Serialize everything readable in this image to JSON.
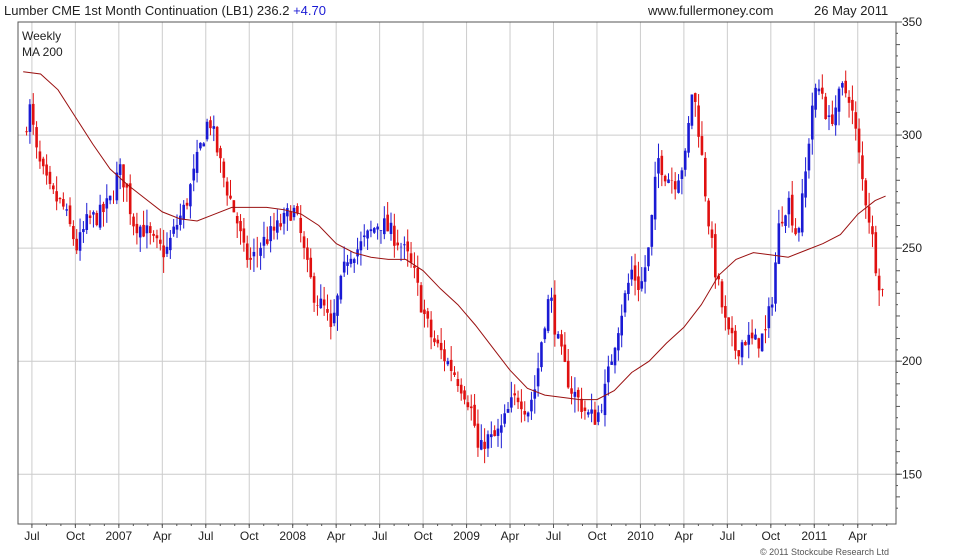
{
  "header": {
    "title": "Lumber CME 1st Month Continuation (LB1) 236.2",
    "change": "+4.70",
    "site": "www.fullermoney.com",
    "date": "26 May 2011"
  },
  "legend": {
    "period": "Weekly",
    "ma": "MA 200"
  },
  "footer": {
    "copyright": "© 2011 Stockcube Research Ltd"
  },
  "colors": {
    "up": "#1a1ad4",
    "down": "#e01010",
    "ma": "#9a1010",
    "grid": "#cccccc",
    "frame": "#555555",
    "change": "#1a1ad4"
  },
  "chart_data": {
    "type": "line",
    "title": "Lumber CME 1st Month Continuation (LB1) 236.2",
    "xlabel": "",
    "ylabel": "",
    "ylim": [
      128,
      350
    ],
    "yticks": [
      150,
      200,
      250,
      300,
      350
    ],
    "grid": true,
    "xticks": [
      {
        "label": "Jul",
        "t": 2006.5
      },
      {
        "label": "Oct",
        "t": 2006.75
      },
      {
        "label": "2007",
        "t": 2007.0
      },
      {
        "label": "Apr",
        "t": 2007.25
      },
      {
        "label": "Jul",
        "t": 2007.5
      },
      {
        "label": "Oct",
        "t": 2007.75
      },
      {
        "label": "2008",
        "t": 2008.0
      },
      {
        "label": "Apr",
        "t": 2008.25
      },
      {
        "label": "Jul",
        "t": 2008.5
      },
      {
        "label": "Oct",
        "t": 2008.75
      },
      {
        "label": "2009",
        "t": 2009.0
      },
      {
        "label": "Apr",
        "t": 2009.25
      },
      {
        "label": "Jul",
        "t": 2009.5
      },
      {
        "label": "Oct",
        "t": 2009.75
      },
      {
        "label": "2010",
        "t": 2010.0
      },
      {
        "label": "Apr",
        "t": 2010.25
      },
      {
        "label": "Jul",
        "t": 2010.5
      },
      {
        "label": "Oct",
        "t": 2010.75
      },
      {
        "label": "2011",
        "t": 2011.0
      },
      {
        "label": "Apr",
        "t": 2011.25
      }
    ],
    "price_path": [
      [
        2006.45,
        300
      ],
      [
        2006.49,
        312
      ],
      [
        2006.53,
        290
      ],
      [
        2006.6,
        275
      ],
      [
        2006.68,
        268
      ],
      [
        2006.76,
        250
      ],
      [
        2006.82,
        262
      ],
      [
        2006.9,
        265
      ],
      [
        2006.96,
        272
      ],
      [
        2007.0,
        285
      ],
      [
        2007.04,
        278
      ],
      [
        2007.08,
        262
      ],
      [
        2007.15,
        258
      ],
      [
        2007.2,
        252
      ],
      [
        2007.27,
        248
      ],
      [
        2007.33,
        260
      ],
      [
        2007.38,
        268
      ],
      [
        2007.43,
        282
      ],
      [
        2007.48,
        298
      ],
      [
        2007.52,
        308
      ],
      [
        2007.56,
        295
      ],
      [
        2007.6,
        282
      ],
      [
        2007.64,
        272
      ],
      [
        2007.68,
        262
      ],
      [
        2007.72,
        248
      ],
      [
        2007.76,
        244
      ],
      [
        2007.82,
        252
      ],
      [
        2007.9,
        258
      ],
      [
        2007.95,
        262
      ],
      [
        2008.0,
        268
      ],
      [
        2008.04,
        258
      ],
      [
        2008.08,
        242
      ],
      [
        2008.13,
        228
      ],
      [
        2008.19,
        222
      ],
      [
        2008.22,
        212
      ],
      [
        2008.26,
        228
      ],
      [
        2008.32,
        248
      ],
      [
        2008.38,
        250
      ],
      [
        2008.44,
        256
      ],
      [
        2008.5,
        262
      ],
      [
        2008.55,
        258
      ],
      [
        2008.6,
        254
      ],
      [
        2008.66,
        246
      ],
      [
        2008.7,
        238
      ],
      [
        2008.75,
        222
      ],
      [
        2008.8,
        210
      ],
      [
        2008.87,
        202
      ],
      [
        2008.93,
        195
      ],
      [
        2009.0,
        185
      ],
      [
        2009.04,
        175
      ],
      [
        2009.07,
        158
      ],
      [
        2009.11,
        166
      ],
      [
        2009.15,
        165
      ],
      [
        2009.2,
        170
      ],
      [
        2009.25,
        180
      ],
      [
        2009.3,
        185
      ],
      [
        2009.35,
        178
      ],
      [
        2009.4,
        190
      ],
      [
        2009.44,
        215
      ],
      [
        2009.48,
        230
      ],
      [
        2009.52,
        210
      ],
      [
        2009.56,
        198
      ],
      [
        2009.6,
        188
      ],
      [
        2009.65,
        182
      ],
      [
        2009.7,
        176
      ],
      [
        2009.75,
        175
      ],
      [
        2009.8,
        188
      ],
      [
        2009.85,
        208
      ],
      [
        2009.9,
        225
      ],
      [
        2009.95,
        240
      ],
      [
        2010.0,
        232
      ],
      [
        2010.05,
        250
      ],
      [
        2010.1,
        290
      ],
      [
        2010.15,
        282
      ],
      [
        2010.2,
        280
      ],
      [
        2010.26,
        290
      ],
      [
        2010.3,
        322
      ],
      [
        2010.34,
        300
      ],
      [
        2010.38,
        270
      ],
      [
        2010.42,
        245
      ],
      [
        2010.46,
        228
      ],
      [
        2010.5,
        212
      ],
      [
        2010.55,
        205
      ],
      [
        2010.6,
        210
      ],
      [
        2010.66,
        208
      ],
      [
        2010.72,
        212
      ],
      [
        2010.76,
        230
      ],
      [
        2010.8,
        262
      ],
      [
        2010.85,
        272
      ],
      [
        2010.9,
        255
      ],
      [
        2010.94,
        275
      ],
      [
        2010.99,
        315
      ],
      [
        2011.04,
        322
      ],
      [
        2011.08,
        304
      ],
      [
        2011.12,
        312
      ],
      [
        2011.16,
        320
      ],
      [
        2011.2,
        318
      ],
      [
        2011.24,
        300
      ],
      [
        2011.28,
        278
      ],
      [
        2011.32,
        262
      ],
      [
        2011.36,
        240
      ],
      [
        2011.39,
        230
      ],
      [
        2011.41,
        236
      ]
    ],
    "ma_path": [
      [
        2006.45,
        328
      ],
      [
        2006.55,
        327
      ],
      [
        2006.65,
        320
      ],
      [
        2006.75,
        308
      ],
      [
        2006.85,
        296
      ],
      [
        2006.95,
        285
      ],
      [
        2007.05,
        278
      ],
      [
        2007.15,
        272
      ],
      [
        2007.25,
        266
      ],
      [
        2007.35,
        263
      ],
      [
        2007.45,
        262
      ],
      [
        2007.55,
        265
      ],
      [
        2007.65,
        268
      ],
      [
        2007.75,
        268
      ],
      [
        2007.85,
        268
      ],
      [
        2007.95,
        267
      ],
      [
        2008.05,
        265
      ],
      [
        2008.15,
        260
      ],
      [
        2008.25,
        252
      ],
      [
        2008.35,
        248
      ],
      [
        2008.45,
        246
      ],
      [
        2008.55,
        245
      ],
      [
        2008.65,
        245
      ],
      [
        2008.75,
        240
      ],
      [
        2008.85,
        232
      ],
      [
        2008.95,
        225
      ],
      [
        2009.05,
        216
      ],
      [
        2009.15,
        206
      ],
      [
        2009.25,
        196
      ],
      [
        2009.35,
        188
      ],
      [
        2009.45,
        185
      ],
      [
        2009.55,
        184
      ],
      [
        2009.65,
        183
      ],
      [
        2009.75,
        183
      ],
      [
        2009.85,
        187
      ],
      [
        2009.95,
        195
      ],
      [
        2010.05,
        200
      ],
      [
        2010.15,
        208
      ],
      [
        2010.25,
        215
      ],
      [
        2010.35,
        225
      ],
      [
        2010.45,
        238
      ],
      [
        2010.55,
        245
      ],
      [
        2010.65,
        248
      ],
      [
        2010.75,
        247
      ],
      [
        2010.85,
        246
      ],
      [
        2010.95,
        249
      ],
      [
        2011.05,
        252
      ],
      [
        2011.15,
        256
      ],
      [
        2011.25,
        265
      ],
      [
        2011.35,
        271
      ],
      [
        2011.41,
        273
      ]
    ]
  }
}
